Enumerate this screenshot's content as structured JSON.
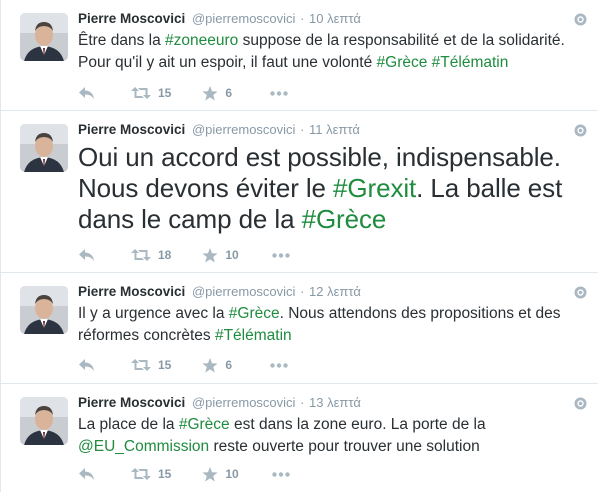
{
  "colors": {
    "hashtag": "#1f8c3f",
    "meta": "#8899a6",
    "text": "#292f33",
    "divider": "#e1e8ed",
    "icon": "#aab8c2"
  },
  "icons": {
    "reply": "reply-icon",
    "retweet": "retweet-icon",
    "favorite": "star-icon",
    "more": "more-dots-icon",
    "corner": "globe-icon"
  },
  "tweets": [
    {
      "author_name": "Pierre Moscovici",
      "author_handle": "@pierremoscovici",
      "separator": "·",
      "time": "10 λεπτά",
      "text_parts": [
        "Être dans la ",
        "#zoneeuro",
        " suppose de la responsabilité et de la solidarité. Pour qu'il y ait un espoir, il faut une volonté ",
        "#Grèce",
        " ",
        "#Télématin"
      ],
      "retweets": "15",
      "favorites": "6"
    },
    {
      "author_name": "Pierre Moscovici",
      "author_handle": "@pierremoscovici",
      "separator": "·",
      "time": "11 λεπτά",
      "text_parts": [
        "Oui un accord est possible, indispensable. Nous devons éviter le ",
        "#Grexit",
        ". La balle est dans le camp de la ",
        "#Grèce"
      ],
      "retweets": "18",
      "favorites": "10"
    },
    {
      "author_name": "Pierre Moscovici",
      "author_handle": "@pierremoscovici",
      "separator": "·",
      "time": "12 λεπτά",
      "text_parts": [
        "Il y a urgence avec la ",
        "#Grèce",
        ". Nous attendons des propositions et des réformes concrètes ",
        "#Télématin"
      ],
      "retweets": "15",
      "favorites": "6"
    },
    {
      "author_name": "Pierre Moscovici",
      "author_handle": "@pierremoscovici",
      "separator": "·",
      "time": "13 λεπτά",
      "text_parts": [
        "La place de la ",
        "#Grèce",
        " est dans la zone euro. La porte de la ",
        "@EU_Commission",
        " reste ouverte pour trouver une solution"
      ],
      "retweets": "15",
      "favorites": "10"
    }
  ]
}
